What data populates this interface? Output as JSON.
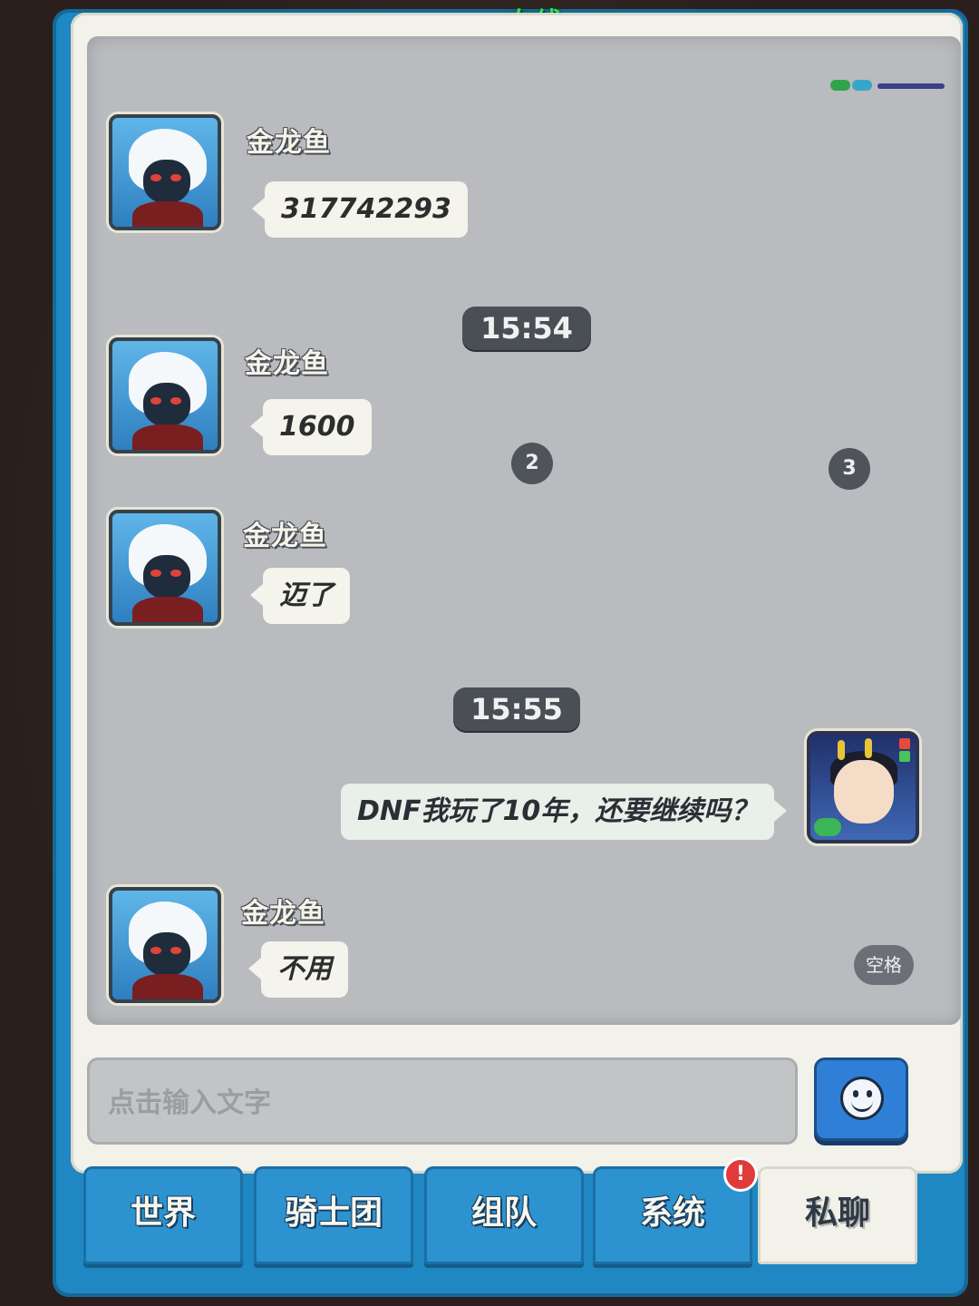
{
  "header": {
    "online_label": "在线"
  },
  "colors": {
    "accent_blue": "#1f87c2",
    "online_green": "#2fdc5f",
    "alert_red": "#e03a3a"
  },
  "messages": [
    {
      "sender": "金龙鱼",
      "text": "317742293",
      "side": "left"
    },
    {
      "time": "15:54"
    },
    {
      "sender": "金龙鱼",
      "text": "1600",
      "side": "left"
    },
    {
      "sender": "金龙鱼",
      "text": "迈了",
      "side": "left"
    },
    {
      "time": "15:55"
    },
    {
      "sender": "",
      "text": "DNF我玩了10年，还要继续吗？",
      "side": "right"
    },
    {
      "sender": "金龙鱼",
      "text": "不用",
      "side": "left"
    }
  ],
  "overlay_numbers": [
    "2",
    "3"
  ],
  "space_button": "空格",
  "input": {
    "placeholder": "点击输入文字",
    "value": ""
  },
  "emoji_icon": "smiley-face-icon",
  "tabs": [
    {
      "label": "世界",
      "active": false
    },
    {
      "label": "骑士团",
      "active": false
    },
    {
      "label": "组队",
      "active": false
    },
    {
      "label": "系统",
      "active": false,
      "badge": "!"
    },
    {
      "label": "私聊",
      "active": true
    }
  ]
}
